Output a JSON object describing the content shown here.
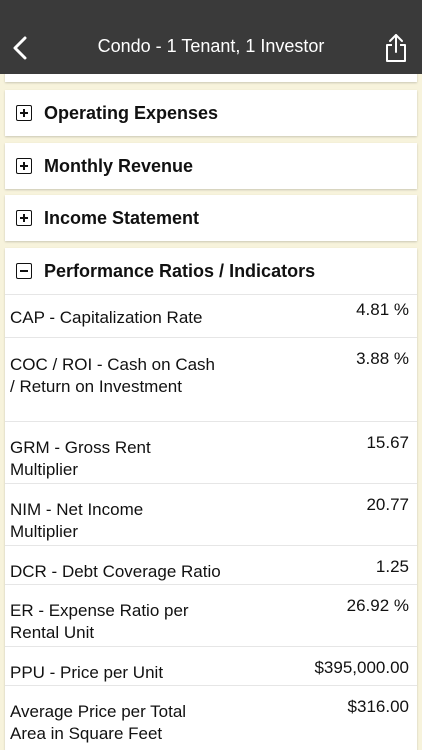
{
  "nav": {
    "title": "Condo - 1 Tenant, 1 Investor"
  },
  "sections": {
    "operating_expenses": "Operating Expenses",
    "monthly_revenue": "Monthly Revenue",
    "income_statement": "Income Statement",
    "performance": "Performance Ratios / Indicators"
  },
  "ratios": [
    {
      "label": "CAP - Capitalization Rate",
      "value": "4.81 %"
    },
    {
      "label": "COC / ROI - Cash on Cash / Return on Investment",
      "value": "3.88 %"
    },
    {
      "label": "GRM - Gross Rent Multiplier",
      "value": "15.67"
    },
    {
      "label": "NIM - Net Income Multiplier",
      "value": "20.77"
    },
    {
      "label": "DCR - Debt Coverage Ratio",
      "value": "1.25"
    },
    {
      "label": "ER - Expense Ratio per Rental Unit",
      "value": "26.92 %"
    },
    {
      "label": "PPU - Price per Unit",
      "value": "$395,000.00"
    },
    {
      "label": "Average Price per Total Area in Square Feet",
      "value": "$316.00"
    }
  ],
  "colors": {
    "navbar": "#3a3a3a",
    "background": "#f7f3dc",
    "card": "#ffffff"
  }
}
